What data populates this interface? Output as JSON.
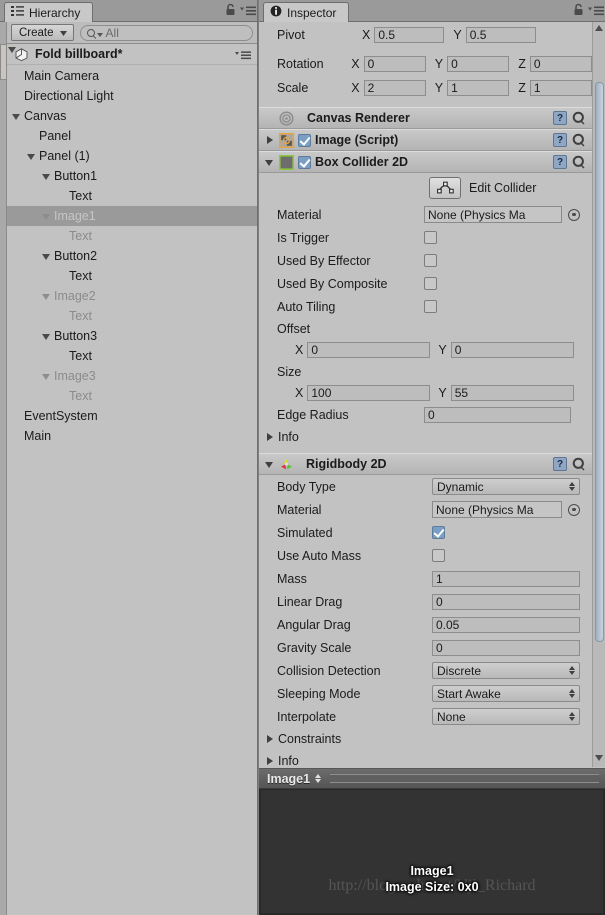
{
  "hierarchy": {
    "tab_label": "Hierarchy",
    "tab_icon": "hierarchy-icon",
    "lock_icon": "lock-icon",
    "menu_icon": "hamburger-menu-icon",
    "create_label": "Create",
    "search_placeholder": "All",
    "search_value": "All",
    "scene_name": "Fold billboard*",
    "items": [
      {
        "label": "Main Camera",
        "depth": 1,
        "fold": "none",
        "dim": false,
        "selected": false
      },
      {
        "label": "Directional Light",
        "depth": 1,
        "fold": "none",
        "dim": false,
        "selected": false
      },
      {
        "label": "Canvas",
        "depth": 1,
        "fold": "down",
        "dim": false,
        "selected": false
      },
      {
        "label": "Panel",
        "depth": 2,
        "fold": "none",
        "dim": false,
        "selected": false
      },
      {
        "label": "Panel (1)",
        "depth": 2,
        "fold": "down",
        "dim": false,
        "selected": false
      },
      {
        "label": "Button1",
        "depth": 3,
        "fold": "down",
        "dim": false,
        "selected": false
      },
      {
        "label": "Text",
        "depth": 4,
        "fold": "none",
        "dim": false,
        "selected": false
      },
      {
        "label": "Image1",
        "depth": 3,
        "fold": "down",
        "dim": true,
        "selected": true
      },
      {
        "label": "Text",
        "depth": 4,
        "fold": "none",
        "dim": true,
        "selected": false
      },
      {
        "label": "Button2",
        "depth": 3,
        "fold": "down",
        "dim": false,
        "selected": false
      },
      {
        "label": "Text",
        "depth": 4,
        "fold": "none",
        "dim": false,
        "selected": false
      },
      {
        "label": "Image2",
        "depth": 3,
        "fold": "down",
        "dim": true,
        "selected": false
      },
      {
        "label": "Text",
        "depth": 4,
        "fold": "none",
        "dim": true,
        "selected": false
      },
      {
        "label": "Button3",
        "depth": 3,
        "fold": "down",
        "dim": false,
        "selected": false
      },
      {
        "label": "Text",
        "depth": 4,
        "fold": "none",
        "dim": false,
        "selected": false
      },
      {
        "label": "Image3",
        "depth": 3,
        "fold": "down",
        "dim": true,
        "selected": false
      },
      {
        "label": "Text",
        "depth": 4,
        "fold": "none",
        "dim": true,
        "selected": false
      },
      {
        "label": "EventSystem",
        "depth": 1,
        "fold": "none",
        "dim": false,
        "selected": false
      },
      {
        "label": "Main",
        "depth": 1,
        "fold": "none",
        "dim": false,
        "selected": false
      }
    ]
  },
  "inspector": {
    "tab_label": "Inspector",
    "tab_icon": "info-icon",
    "lock_icon": "lock-icon",
    "menu_icon": "hamburger-menu-icon",
    "transform": {
      "pivot_label": "Pivot",
      "pivot_x_axis": "X",
      "pivot_x": "0.5",
      "pivot_y_axis": "Y",
      "pivot_y": "0.5",
      "rotation_label": "Rotation",
      "rot_x_axis": "X",
      "rot_x": "0",
      "rot_y_axis": "Y",
      "rot_y": "0",
      "rot_z_axis": "Z",
      "rot_z": "0",
      "scale_label": "Scale",
      "scale_x_axis": "X",
      "scale_x": "2",
      "scale_y_axis": "Y",
      "scale_y": "1",
      "scale_z_axis": "Z",
      "scale_z": "1"
    },
    "canvas_renderer": {
      "title": "Canvas Renderer",
      "icon": "canvas-renderer-icon",
      "help_label": "?"
    },
    "image_script": {
      "title": "Image (Script)",
      "icon": "image-script-icon",
      "enabled": true,
      "help_label": "?"
    },
    "box_collider": {
      "title": "Box Collider 2D",
      "icon": "box-collider-2d-icon",
      "enabled": true,
      "help_label": "?",
      "edit_collider_label": "Edit Collider",
      "edit_collider_icon": "collider-edit-icon",
      "material_label": "Material",
      "material_value": "None (Physics Ma",
      "is_trigger_label": "Is Trigger",
      "is_trigger": false,
      "used_by_effector_label": "Used By Effector",
      "used_by_effector": false,
      "used_by_composite_label": "Used By Composite",
      "used_by_composite": false,
      "auto_tiling_label": "Auto Tiling",
      "auto_tiling": false,
      "offset_label": "Offset",
      "offset_x_axis": "X",
      "offset_x": "0",
      "offset_y_axis": "Y",
      "offset_y": "0",
      "size_label": "Size",
      "size_x_axis": "X",
      "size_x": "100",
      "size_y_axis": "Y",
      "size_y": "55",
      "edge_radius_label": "Edge Radius",
      "edge_radius": "0",
      "info_label": "Info"
    },
    "rigidbody": {
      "title": "Rigidbody 2D",
      "icon": "rigidbody-2d-icon",
      "help_label": "?",
      "body_type_label": "Body Type",
      "body_type_value": "Dynamic",
      "material_label": "Material",
      "material_value": "None (Physics Ma",
      "simulated_label": "Simulated",
      "simulated": true,
      "use_auto_mass_label": "Use Auto Mass",
      "use_auto_mass": false,
      "mass_label": "Mass",
      "mass_value": "1",
      "linear_drag_label": "Linear Drag",
      "linear_drag_value": "0",
      "angular_drag_label": "Angular Drag",
      "angular_drag_value": "0.05",
      "gravity_scale_label": "Gravity Scale",
      "gravity_scale_value": "0",
      "collision_detection_label": "Collision Detection",
      "collision_detection_value": "Discrete",
      "sleeping_mode_label": "Sleeping Mode",
      "sleeping_mode_value": "Start Awake",
      "interpolate_label": "Interpolate",
      "interpolate_value": "None",
      "constraints_label": "Constraints",
      "info_label": "Info"
    }
  },
  "preview": {
    "title": "Image1",
    "object_name": "Image1",
    "size_text": "Image Size: 0x0",
    "watermark": "http://blog.csdn.net/Vjl_Richard"
  },
  "colors": {
    "panel_bg": "#c2c2c2",
    "selection": "#9a9a9a",
    "checkbox_on": "#7a9ec4",
    "collider_icon_border": "#8ec63f",
    "script_icon_border": "#e8a33d",
    "preview_bg": "#333333"
  }
}
